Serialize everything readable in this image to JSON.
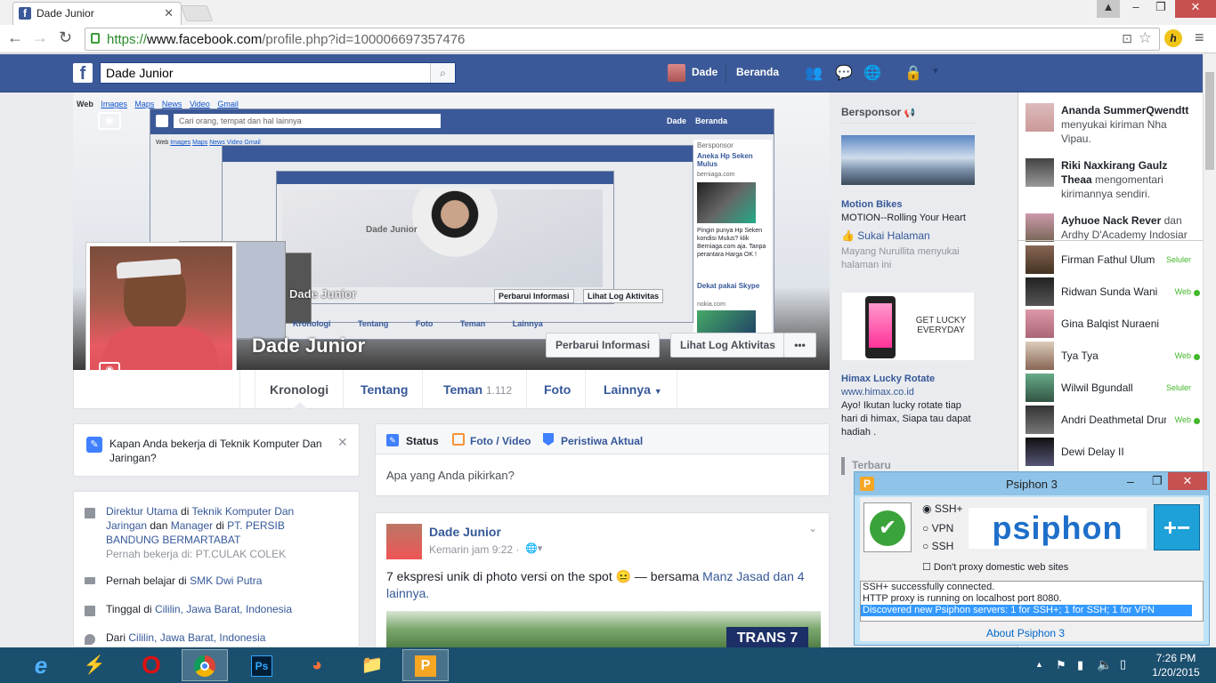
{
  "browser": {
    "tab_title": "Dade Junior",
    "url_scheme": "https://",
    "url_host": "www.facebook.com",
    "url_path": "/profile.php?id=100006697357476"
  },
  "fb_nav": {
    "search_value": "Dade Junior",
    "user_name": "Dade",
    "home_label": "Beranda"
  },
  "cover": {
    "name": "Dade Junior",
    "update_info": "Perbarui Informasi",
    "activity_log": "Lihat Log Aktivitas",
    "more": "•••",
    "nested_search": "Cari orang, tempat dan hal lainnya",
    "nested_links": [
      "Web",
      "Images",
      "Maps",
      "News",
      "Video",
      "Gmail"
    ]
  },
  "tabs": {
    "kronologi": "Kronologi",
    "tentang": "Tentang",
    "teman": "Teman",
    "teman_count": "1.112",
    "foto": "Foto",
    "lainnya": "Lainnya"
  },
  "prompt": {
    "text": "Kapan Anda bekerja di Teknik Komputer Dan Jaringan?"
  },
  "intro": {
    "job_title": "Direktur Utama",
    "job_at": "di",
    "job_place": "Teknik Komputer Dan Jaringan",
    "job_and": "dan",
    "job_title2": "Manager",
    "job_at2": "di",
    "job_place2": "PT. PERSIB BANDUNG BERMARTABAT",
    "past_job": "Pernah bekerja di: PT.CULAK COLEK",
    "school_pre": "Pernah belajar di",
    "school": "SMK Dwi Putra",
    "live_pre": "Tinggal di",
    "live": "Cililin, Jawa Barat, Indonesia",
    "from_pre": "Dari",
    "from": "Cililin, Jawa Barat, Indonesia"
  },
  "composer": {
    "status": "Status",
    "photo": "Foto / Video",
    "event": "Peristiwa Aktual",
    "placeholder": "Apa yang Anda pikirkan?"
  },
  "post": {
    "author": "Dade Junior",
    "time": "Kemarin jam 9:22 ·",
    "text": "7 ekspresi unik di photo versi on the spot 😐 — bersama",
    "with1": "Manz Jasad",
    "and": "dan",
    "with2": "4 lainnya.",
    "watermark": "TRANS 7"
  },
  "sponsor": {
    "heading": "Bersponsor",
    "ad1_title": "Motion Bikes",
    "ad1_desc": "MOTION--Rolling Your Heart",
    "ad1_like": "Sukai Halaman",
    "ad1_social": "Mayang Nurullita menyukai halaman ini",
    "ad2_img_text": "GET LUCKY EVERYDAY",
    "ad2_title": "Himax Lucky Rotate",
    "ad2_url": "www.himax.co.id",
    "ad2_desc": "Ayo! Ikutan lucky rotate tiap hari di himax, Siapa tau dapat hadiah .",
    "recent": "Terbaru"
  },
  "ticker": [
    {
      "name": "Ananda SummerQwendtt",
      "rest": "menyukai kiriman Nha Vipau."
    },
    {
      "name": "Riki Naxkirang Gaulz Theaa",
      "rest": "mengomentari kirimannya sendiri."
    },
    {
      "name": "Ayhuoe Nack Rever",
      "rest": "dan Ardhy D'Academy Indosiar"
    }
  ],
  "chat": [
    {
      "name": "Firman Fathul Ulum",
      "status": "Seluler"
    },
    {
      "name": "Ridwan Sunda Wani",
      "status": "Web"
    },
    {
      "name": "Gina Balqist Nuraeni",
      "status": ""
    },
    {
      "name": "Tya Tya",
      "status": "Web"
    },
    {
      "name": "Wilwil Bgundall",
      "status": "Seluler"
    },
    {
      "name": "Andri Deathmetal Drum",
      "status": "Web"
    },
    {
      "name": "Dewi Delay II",
      "status": ""
    }
  ],
  "psiphon": {
    "title": "Psiphon 3",
    "opt1": "SSH+",
    "opt2": "VPN",
    "opt3": "SSH",
    "logo": "psiphon",
    "checkbox": "Don't proxy domestic web sites",
    "log1": "SSH+ successfully connected.",
    "log2": "HTTP proxy is running on localhost port 8080.",
    "log3": "Discovered new Psiphon servers: 1 for SSH+; 1 for SSH; 1 for VPN",
    "about": "About Psiphon 3"
  },
  "taskbar": {
    "time": "7:26 PM",
    "date": "1/20/2015",
    "ps_label": "Ps"
  },
  "colors": {
    "fb_blue": "#3b5998",
    "link": "#365899",
    "online": "#42b72a"
  }
}
